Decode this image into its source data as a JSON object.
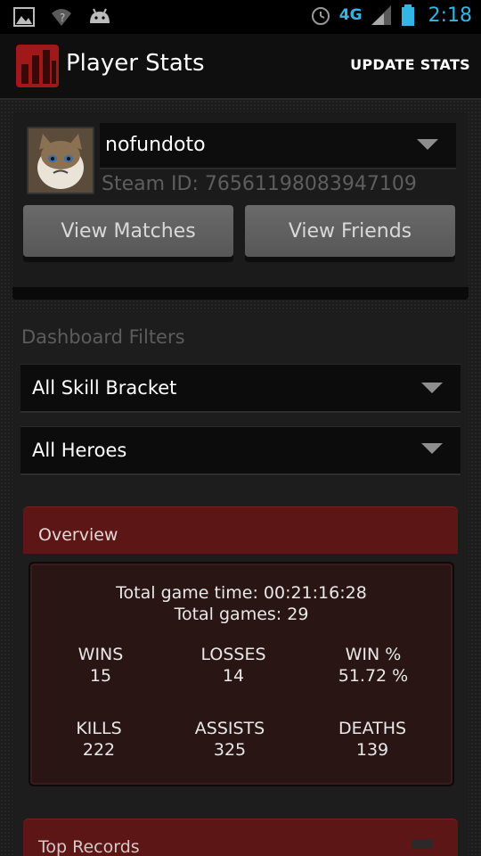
{
  "status_bar": {
    "network": "4G",
    "time": "2:18"
  },
  "action_bar": {
    "title": "Player Stats",
    "update_label": "UPDATE STATS"
  },
  "player": {
    "name": "nofundoto",
    "steam_id": "Steam ID: 76561198083947109",
    "view_matches_label": "View Matches",
    "view_friends_label": "View Friends"
  },
  "filters": {
    "title": "Dashboard Filters",
    "skill_bracket": "All Skill Bracket",
    "heroes": "All Heroes"
  },
  "overview": {
    "title": "Overview",
    "total_game_time": "Total game time: 00:21:16:28",
    "total_games": "Total games: 29",
    "stats": {
      "wins_label": "WINS",
      "wins": "15",
      "losses_label": "LOSSES",
      "losses": "14",
      "winpct_label": "WIN %",
      "winpct": "51.72 %",
      "kills_label": "KILLS",
      "kills": "222",
      "assists_label": "ASSISTS",
      "assists": "325",
      "deaths_label": "DEATHS",
      "deaths": "139"
    }
  },
  "next_section": {
    "title": "Top Records"
  },
  "colors": {
    "accent_blue": "#33b5e5",
    "section_red": "#5c1616",
    "overview_bg": "#2a1515"
  }
}
